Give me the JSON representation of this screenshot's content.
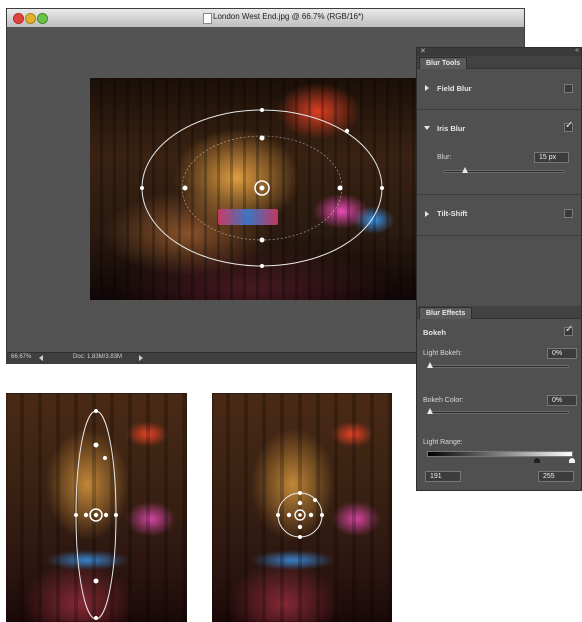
{
  "window": {
    "title": "London West End.jpg @ 66.7% (RGB/16*)",
    "zoom": "66.67%",
    "doc_info": "Doc: 1.83M/3.83M"
  },
  "panel": {
    "tab_title": "Blur Tools",
    "field_blur": {
      "label": "Field Blur",
      "expanded": false,
      "enabled": false
    },
    "iris_blur": {
      "label": "Iris Blur",
      "expanded": true,
      "enabled": true,
      "blur_label": "Blur:",
      "blur_value": "15 px",
      "blur_slider": 0.18
    },
    "tilt_shift": {
      "label": "Tilt-Shift",
      "expanded": false,
      "enabled": false
    },
    "effects_tab": "Blur Effects",
    "bokeh": {
      "label": "Bokeh",
      "enabled": true,
      "light_bokeh_label": "Light Bokeh:",
      "light_bokeh_value": "0%",
      "light_bokeh_slider": 0.0,
      "bokeh_color_label": "Bokeh Color:",
      "bokeh_color_value": "0%",
      "bokeh_color_slider": 0.0,
      "light_range_label": "Light Range:",
      "light_range_low": "191",
      "light_range_high": "255"
    }
  },
  "icons": {
    "close": "close-icon",
    "collapse": "collapse-icon",
    "expand_right": "triangle-right-icon",
    "expand_down": "triangle-down-icon",
    "check": "checkmark-icon"
  },
  "colors": {
    "panel_bg": "#505050",
    "canvas_bg": "#535353",
    "overlay_stroke": "#e8e8e8"
  }
}
